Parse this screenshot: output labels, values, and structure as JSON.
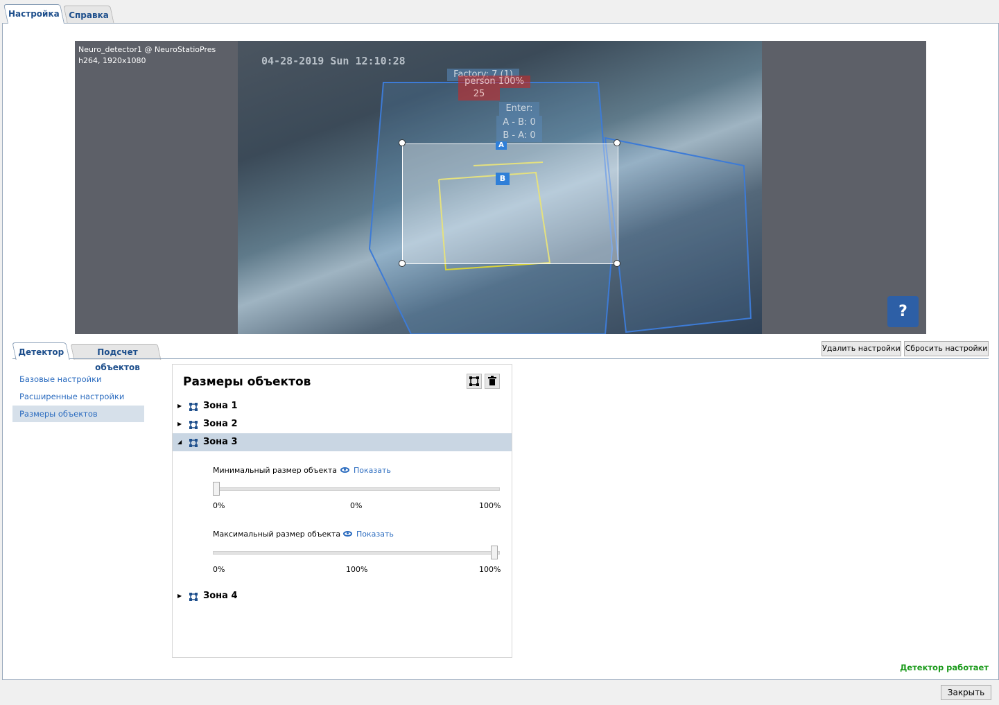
{
  "top_tabs": [
    "Настройка",
    "Справка"
  ],
  "video": {
    "overlay_line1": "Neuro_detector1 @ NeuroStatioPres",
    "overlay_line2": "h264, 1920x1080",
    "timestamp": "04-28-2019 Sun 12:10:28",
    "factory_label": "Factory: 7 (1)",
    "person_label": "person 100%",
    "person_id": "25",
    "enter_label": "Enter:",
    "ab_count": "A - B: 0",
    "ba_count": "B - A: 0",
    "marker_a": "A",
    "marker_b": "B",
    "help_label": "?"
  },
  "sub_tabs": [
    "Детектор",
    "Подсчет объектов"
  ],
  "buttons": {
    "delete_settings": "Удалить настройки",
    "reset_settings": "Сбросить настройки",
    "close": "Закрыть"
  },
  "nav": [
    "Базовые настройки",
    "Расширенные настройки",
    "Размеры объектов"
  ],
  "panel": {
    "title": "Размеры объектов",
    "zones": [
      "Зона 1",
      "Зона 2",
      "Зона 3",
      "Зона 4"
    ],
    "min_size": {
      "label": "Минимальный размер объекта",
      "show": "Показать",
      "value": "0%",
      "min": "0%",
      "max": "100%",
      "fraction": 0
    },
    "max_size": {
      "label": "Максимальный размер объекта",
      "show": "Показать",
      "value": "100%",
      "min": "0%",
      "max": "100%",
      "fraction": 1
    }
  },
  "status": {
    "text": "Детектор работает",
    "color": "#1a9a1a"
  },
  "colors": {
    "accent": "#1e4f8c",
    "link": "#2a6bbf",
    "selection": "#c9d6e3",
    "help_button": "#2d5fa6"
  }
}
